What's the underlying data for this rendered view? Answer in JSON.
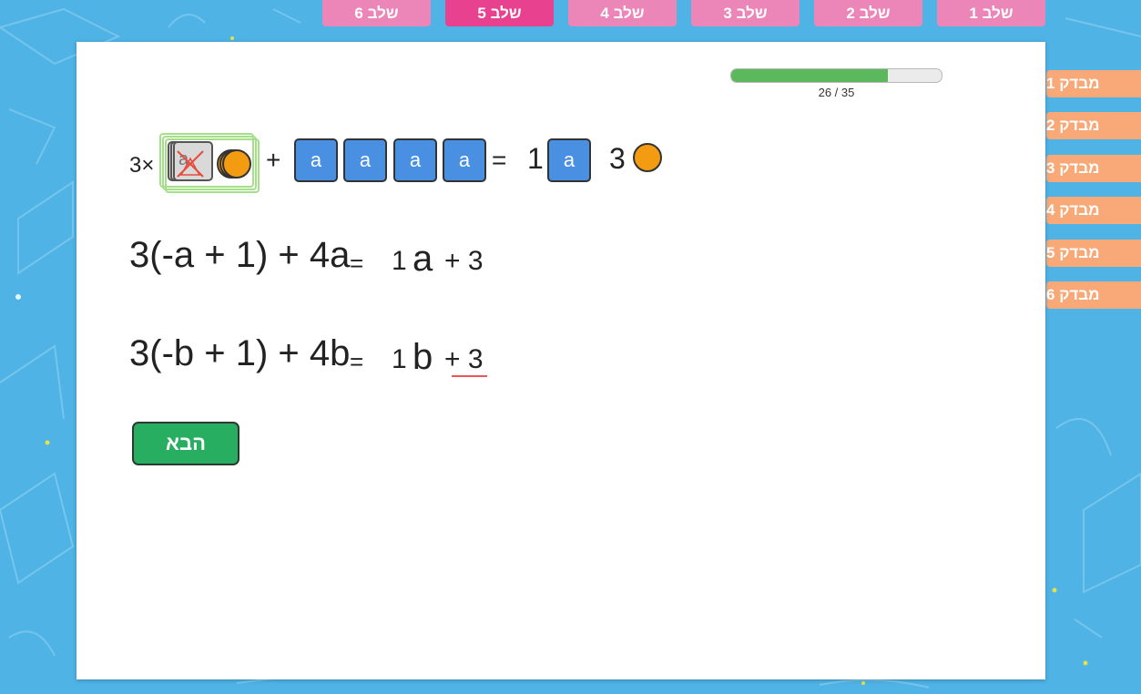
{
  "stages": [
    {
      "label": "שלב 1",
      "active": false
    },
    {
      "label": "שלב 2",
      "active": false
    },
    {
      "label": "שלב 3",
      "active": false
    },
    {
      "label": "שלב 4",
      "active": false
    },
    {
      "label": "שלב 5",
      "active": true
    },
    {
      "label": "שלב 6",
      "active": false
    }
  ],
  "tests": [
    "מבדק 1",
    "מבדק 2",
    "מבדק 3",
    "מבדק 4",
    "מבדק 5",
    "מבדק 6"
  ],
  "progress": {
    "current": 26,
    "total": 35,
    "label": "26 / 35"
  },
  "blocks": {
    "multiplier": "3×",
    "negative_tile_label": "a",
    "plus": "+",
    "tiles": [
      "a",
      "a",
      "a",
      "a"
    ],
    "equals": "=",
    "result_coef": "1",
    "result_tile": "a",
    "result_const": "3"
  },
  "equation1": {
    "expr": "3(-a + 1) + 4a",
    "eq": "=",
    "coef": "1",
    "var": "a",
    "const": "+ 3"
  },
  "equation2": {
    "expr": "3(-b + 1) + 4b",
    "eq": "=",
    "coef": "1",
    "var": "b",
    "const": "+ 3"
  },
  "next_button": "הבא",
  "colors": {
    "background": "#4fb3e5",
    "stage_tab": "#ec86b8",
    "stage_tab_active": "#e8418f",
    "test_tab": "#f9a877",
    "tile_blue": "#4a90e2",
    "unit_orange": "#f39c12",
    "progress_green": "#5cb85c",
    "button_green": "#27ae60"
  }
}
